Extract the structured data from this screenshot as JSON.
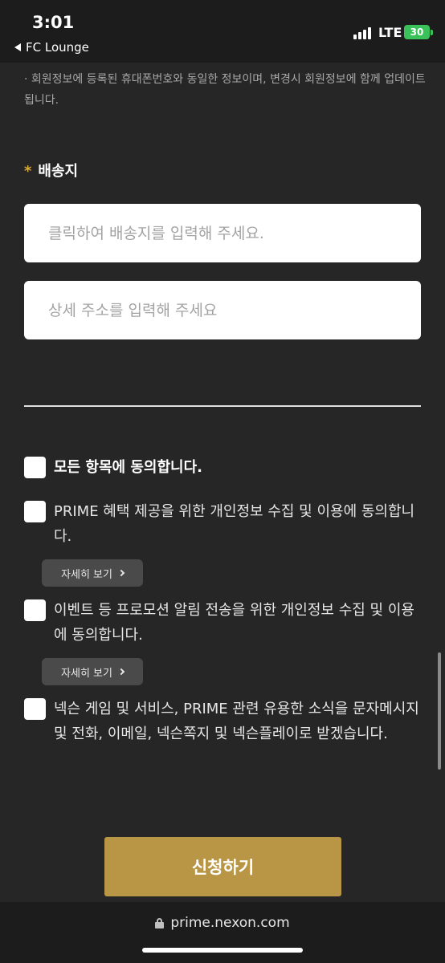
{
  "status_bar": {
    "time": "3:01",
    "back_app": "FC Lounge",
    "network": "LTE",
    "battery": "30"
  },
  "form": {
    "notice": "· 회원정보에 등록된 휴대폰번호와 동일한 정보이며, 변경시 회원정보에 함께 업데이트 됩니다.",
    "section_required_mark": "*",
    "section_title": "배송지",
    "address_placeholder": "클릭하여 배송지를 입력해 주세요.",
    "detail_address_placeholder": "상세 주소를 입력해 주세요"
  },
  "agreements": {
    "all": "모든 항목에 동의합니다.",
    "items": [
      {
        "label": "PRIME 혜택 제공을 위한 개인정보 수집 및 이용에 동의합니다.",
        "detail_button": "자세히 보기"
      },
      {
        "label": "이벤트 등 프로모션 알림 전송을 위한 개인정보 수집 및 이용에 동의합니다.",
        "detail_button": "자세히 보기"
      },
      {
        "label": "넥슨 게임 및 서비스, PRIME 관련 유용한 소식을 문자메시지 및 전화, 이메일, 넥슨쪽지 및 넥슨플레이로 받겠습니다."
      }
    ]
  },
  "submit_label": "신청하기",
  "browser": {
    "url": "prime.nexon.com"
  },
  "colors": {
    "background": "#262626",
    "accent": "#b99646",
    "required_mark": "#d6a93a",
    "battery": "#3bc15a"
  }
}
